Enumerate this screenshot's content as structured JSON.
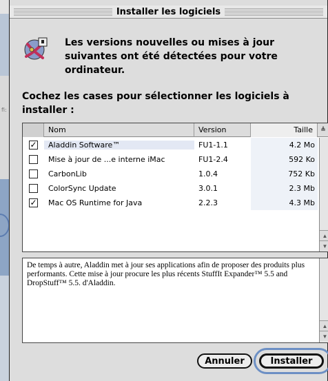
{
  "window": {
    "title": "Installer les logiciels"
  },
  "background": {
    "fragment_text": "fi:"
  },
  "icons": {
    "app": "aladdin-installer-icon",
    "sort": "sort-arrow-icon",
    "scroll_up": "scroll-up-arrow-icon",
    "scroll_down": "scroll-down-arrow-icon"
  },
  "message": {
    "heading": "Les versions nouvelles ou mises à jour suivantes ont été détectées pour votre ordinateur.",
    "instruction": "Cochez les cases pour sélectionner les logiciels à installer :"
  },
  "table": {
    "columns": {
      "name": "Nom",
      "version": "Version",
      "size": "Taille"
    },
    "rows": [
      {
        "checked": true,
        "name": "Aladdin Software™",
        "version": "FU1-1.1",
        "size": "4.2 Mo"
      },
      {
        "checked": false,
        "name": "Mise à jour de ...e interne iMac",
        "version": "FU1-2.4",
        "size": "592 Ko"
      },
      {
        "checked": false,
        "name": "CarbonLib",
        "version": "1.0.4",
        "size": "752 Kb"
      },
      {
        "checked": false,
        "name": "ColorSync Update",
        "version": "3.0.1",
        "size": "2.3 Mb"
      },
      {
        "checked": true,
        "name": "Mac OS Runtime for Java",
        "version": "2.2.3",
        "size": "4.3 Mb"
      }
    ]
  },
  "description": {
    "text": "De temps à autre, Aladdin met à jour ses applications afin de proposer des produits plus performants. Cette mise à jour procure les plus récents StuffIt Expander™ 5.5 and DropStuff™ 5.5. d'Aladdin."
  },
  "buttons": {
    "cancel": "Annuler",
    "install": "Installer"
  },
  "colors": {
    "highlight_ring": "#6c8fc4",
    "dialog_bg": "#dddddd"
  }
}
